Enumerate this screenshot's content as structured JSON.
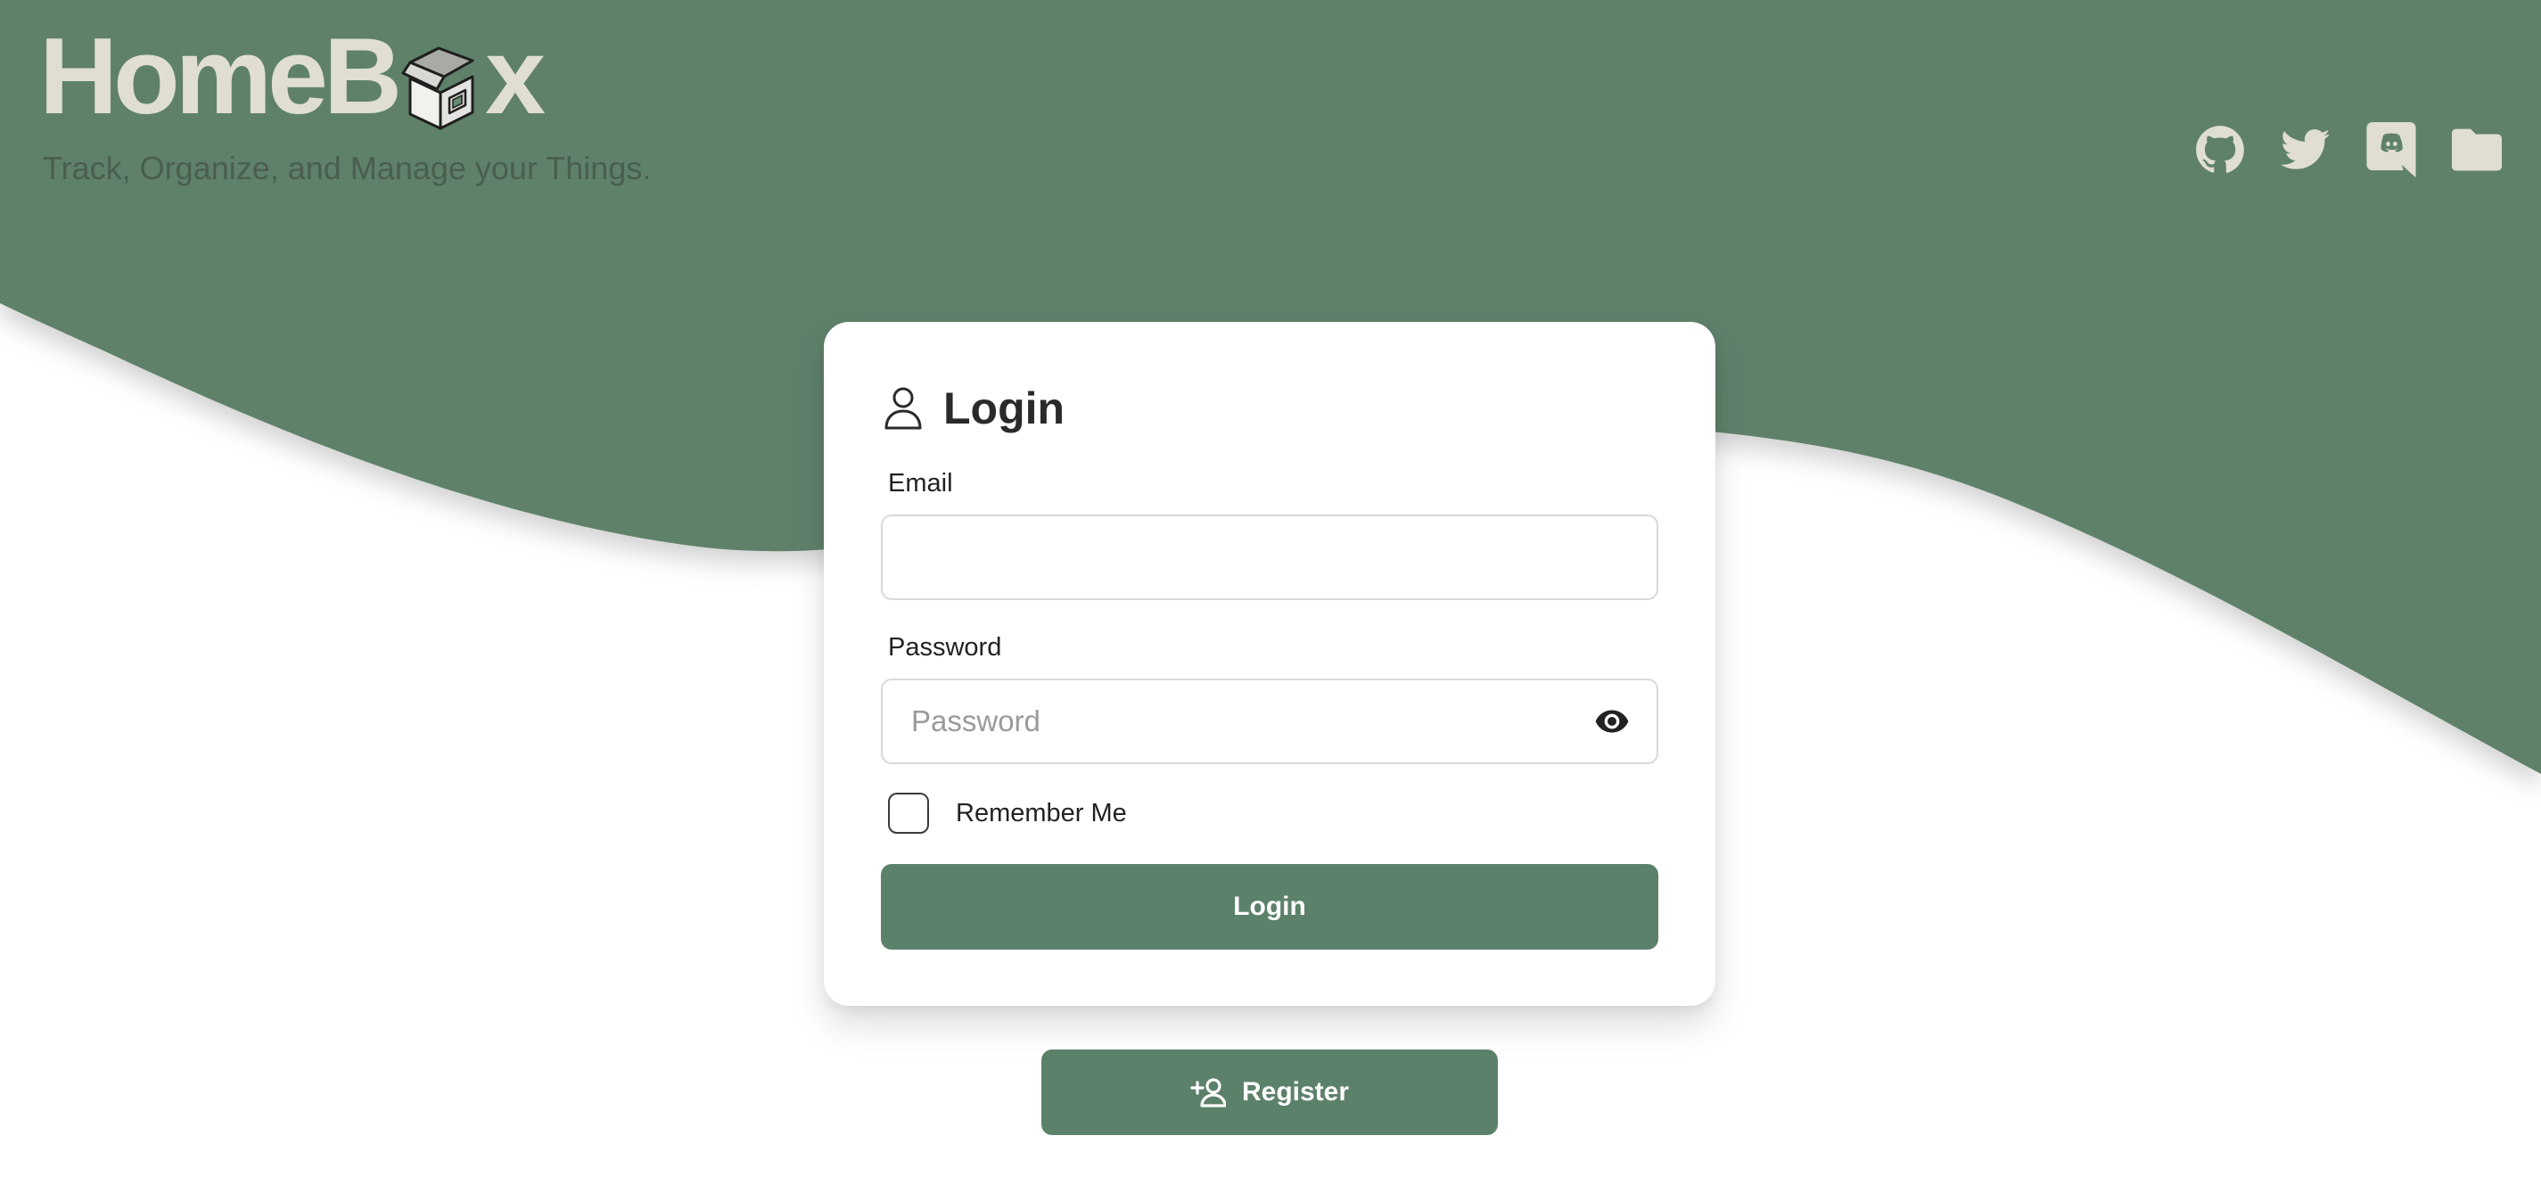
{
  "brand": {
    "logo_prefix": "HomeB",
    "logo_suffix": "x",
    "tagline": "Track, Organize, and Manage your Things.",
    "accent_color": "#5c816a",
    "logo_color": "#e0ded3"
  },
  "social": [
    {
      "name": "github-icon"
    },
    {
      "name": "twitter-icon"
    },
    {
      "name": "discord-icon"
    },
    {
      "name": "folder-icon"
    }
  ],
  "login_card": {
    "title": "Login",
    "email": {
      "label": "Email",
      "value": "",
      "placeholder": ""
    },
    "password": {
      "label": "Password",
      "value": "",
      "placeholder": "Password"
    },
    "remember_label": "Remember Me",
    "remember_checked": false,
    "submit_label": "Login"
  },
  "register": {
    "label": "Register"
  }
}
